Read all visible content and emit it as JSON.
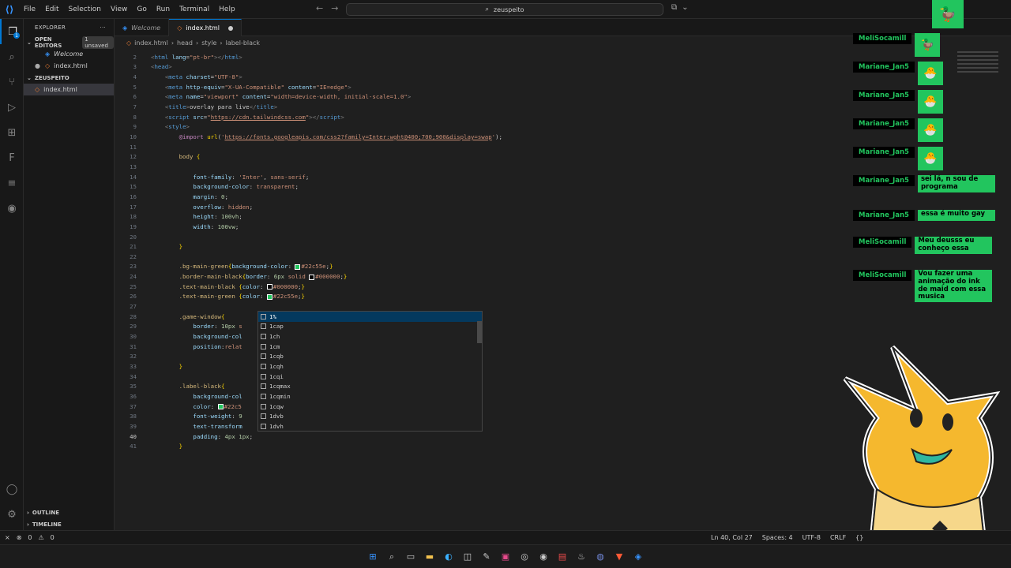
{
  "menu": [
    "File",
    "Edit",
    "Selection",
    "View",
    "Go",
    "Run",
    "Terminal",
    "Help"
  ],
  "command_center": "zeuspeito",
  "explorer": {
    "title": "EXPLORER",
    "open_editors": "OPEN EDITORS",
    "unsaved_badge": "1 unsaved",
    "open_items": [
      "Welcome",
      "index.html"
    ],
    "project": "ZEUSPEITO",
    "project_items": [
      "index.html"
    ],
    "outline": "OUTLINE",
    "timeline": "TIMELINE"
  },
  "tabs": [
    {
      "label": "Welcome"
    },
    {
      "label": "index.html"
    }
  ],
  "breadcrumb": [
    "index.html",
    "head",
    "style",
    "label-black"
  ],
  "code_lines": [
    {
      "n": "2",
      "segs": [
        [
          "punc",
          "<"
        ],
        [
          "tag",
          "html "
        ],
        [
          "attr",
          "lang"
        ],
        [
          "txt",
          "="
        ],
        [
          "str",
          "\"pt-br\""
        ],
        [
          "punc",
          "></"
        ],
        [
          "tag",
          "html"
        ],
        [
          "punc",
          ">"
        ]
      ]
    },
    {
      "n": "3",
      "segs": [
        [
          "punc",
          "<"
        ],
        [
          "tag",
          "head"
        ],
        [
          "punc",
          ">"
        ]
      ]
    },
    {
      "n": "4",
      "segs": [
        [
          "txt",
          "    "
        ],
        [
          "punc",
          "<"
        ],
        [
          "tag",
          "meta "
        ],
        [
          "attr",
          "charset"
        ],
        [
          "txt",
          "="
        ],
        [
          "str",
          "\"UTF-8\""
        ],
        [
          "punc",
          ">"
        ]
      ]
    },
    {
      "n": "5",
      "segs": [
        [
          "txt",
          "    "
        ],
        [
          "punc",
          "<"
        ],
        [
          "tag",
          "meta "
        ],
        [
          "attr",
          "http-equiv"
        ],
        [
          "txt",
          "="
        ],
        [
          "str",
          "\"X-UA-Compatible\""
        ],
        [
          "txt",
          " "
        ],
        [
          "attr",
          "content"
        ],
        [
          "txt",
          "="
        ],
        [
          "str",
          "\"IE=edge\""
        ],
        [
          "punc",
          ">"
        ]
      ]
    },
    {
      "n": "6",
      "segs": [
        [
          "txt",
          "    "
        ],
        [
          "punc",
          "<"
        ],
        [
          "tag",
          "meta "
        ],
        [
          "attr",
          "name"
        ],
        [
          "txt",
          "="
        ],
        [
          "str",
          "\"viewport\""
        ],
        [
          "txt",
          " "
        ],
        [
          "attr",
          "content"
        ],
        [
          "txt",
          "="
        ],
        [
          "str",
          "\"width=device-width, initial-scale=1.0\""
        ],
        [
          "punc",
          ">"
        ]
      ]
    },
    {
      "n": "7",
      "segs": [
        [
          "txt",
          "    "
        ],
        [
          "punc",
          "<"
        ],
        [
          "tag",
          "title"
        ],
        [
          "punc",
          ">"
        ],
        [
          "txt",
          "overlay para live"
        ],
        [
          "punc",
          "</"
        ],
        [
          "tag",
          "title"
        ],
        [
          "punc",
          ">"
        ]
      ]
    },
    {
      "n": "8",
      "segs": [
        [
          "txt",
          "    "
        ],
        [
          "punc",
          "<"
        ],
        [
          "tag",
          "script "
        ],
        [
          "attr",
          "src"
        ],
        [
          "txt",
          "="
        ],
        [
          "str",
          "\""
        ],
        [
          "link",
          "https://cdn.tailwindcss.com"
        ],
        [
          "str",
          "\""
        ],
        [
          "punc",
          "></"
        ],
        [
          "tag",
          "script"
        ],
        [
          "punc",
          ">"
        ]
      ]
    },
    {
      "n": "9",
      "segs": [
        [
          "txt",
          "    "
        ],
        [
          "punc",
          "<"
        ],
        [
          "tag",
          "style"
        ],
        [
          "punc",
          ">"
        ]
      ]
    },
    {
      "n": "10",
      "segs": [
        [
          "txt",
          "        "
        ],
        [
          "at",
          "@import "
        ],
        [
          "yel",
          "url"
        ],
        [
          "txt",
          "("
        ],
        [
          "str",
          "'"
        ],
        [
          "link",
          "https://fonts.googleapis.com/css2?family=Inter:wght@400;700;900&display=swap"
        ],
        [
          "str",
          "'"
        ],
        [
          "txt",
          ");"
        ]
      ]
    },
    {
      "n": "11",
      "segs": []
    },
    {
      "n": "12",
      "segs": [
        [
          "txt",
          "        "
        ],
        [
          "sel",
          "body "
        ],
        [
          "yel",
          "{"
        ]
      ]
    },
    {
      "n": "13",
      "segs": []
    },
    {
      "n": "14",
      "segs": [
        [
          "txt",
          "            "
        ],
        [
          "prop",
          "font-family"
        ],
        [
          "txt",
          ": "
        ],
        [
          "str",
          "'Inter'"
        ],
        [
          "txt",
          ", "
        ],
        [
          "str",
          "sans-serif"
        ],
        [
          "txt",
          ";"
        ]
      ]
    },
    {
      "n": "15",
      "segs": [
        [
          "txt",
          "            "
        ],
        [
          "prop",
          "background-color"
        ],
        [
          "txt",
          ": "
        ],
        [
          "str",
          "transparent"
        ],
        [
          "txt",
          ";"
        ]
      ]
    },
    {
      "n": "16",
      "segs": [
        [
          "txt",
          "            "
        ],
        [
          "prop",
          "margin"
        ],
        [
          "txt",
          ": "
        ],
        [
          "num",
          "0"
        ],
        [
          "txt",
          ";"
        ]
      ]
    },
    {
      "n": "17",
      "segs": [
        [
          "txt",
          "            "
        ],
        [
          "prop",
          "overflow"
        ],
        [
          "txt",
          ": "
        ],
        [
          "str",
          "hidden"
        ],
        [
          "txt",
          ";"
        ]
      ]
    },
    {
      "n": "18",
      "segs": [
        [
          "txt",
          "            "
        ],
        [
          "prop",
          "height"
        ],
        [
          "txt",
          ": "
        ],
        [
          "num",
          "100vh"
        ],
        [
          "txt",
          ";"
        ]
      ]
    },
    {
      "n": "19",
      "segs": [
        [
          "txt",
          "            "
        ],
        [
          "prop",
          "width"
        ],
        [
          "txt",
          ": "
        ],
        [
          "num",
          "100vw"
        ],
        [
          "txt",
          ";"
        ]
      ]
    },
    {
      "n": "20",
      "segs": []
    },
    {
      "n": "21",
      "segs": [
        [
          "txt",
          "        "
        ],
        [
          "yel",
          "}"
        ]
      ]
    },
    {
      "n": "22",
      "segs": []
    },
    {
      "n": "23",
      "segs": [
        [
          "txt",
          "        "
        ],
        [
          "sel",
          ".bg-main-green"
        ],
        [
          "yel",
          "{"
        ],
        [
          "prop",
          "background-color"
        ],
        [
          "txt",
          ": "
        ],
        [
          "swg",
          ""
        ],
        [
          "str",
          "#22c55e"
        ],
        [
          "txt",
          ";"
        ],
        [
          "yel",
          "}"
        ]
      ]
    },
    {
      "n": "24",
      "segs": [
        [
          "txt",
          "        "
        ],
        [
          "sel",
          ".border-main-black"
        ],
        [
          "yel",
          "{"
        ],
        [
          "prop",
          "border"
        ],
        [
          "txt",
          ": "
        ],
        [
          "num",
          "6px "
        ],
        [
          "str",
          "solid "
        ],
        [
          "swb",
          ""
        ],
        [
          "str",
          "#000000"
        ],
        [
          "txt",
          ";"
        ],
        [
          "yel",
          "}"
        ]
      ]
    },
    {
      "n": "25",
      "segs": [
        [
          "txt",
          "        "
        ],
        [
          "sel",
          ".text-main-black "
        ],
        [
          "yel",
          "{"
        ],
        [
          "prop",
          "color"
        ],
        [
          "txt",
          ": "
        ],
        [
          "swb",
          ""
        ],
        [
          "str",
          "#000000"
        ],
        [
          "txt",
          ";"
        ],
        [
          "yel",
          "}"
        ]
      ]
    },
    {
      "n": "26",
      "segs": [
        [
          "txt",
          "        "
        ],
        [
          "sel",
          ".text-main-green "
        ],
        [
          "yel",
          "{"
        ],
        [
          "prop",
          "color"
        ],
        [
          "txt",
          ": "
        ],
        [
          "swg",
          ""
        ],
        [
          "str",
          "#22c55e"
        ],
        [
          "txt",
          ";"
        ],
        [
          "yel",
          "}"
        ]
      ]
    },
    {
      "n": "27",
      "segs": []
    },
    {
      "n": "28",
      "segs": [
        [
          "txt",
          "        "
        ],
        [
          "sel",
          ".game-window"
        ],
        [
          "yel",
          "{"
        ]
      ]
    },
    {
      "n": "29",
      "segs": [
        [
          "txt",
          "            "
        ],
        [
          "prop",
          "border"
        ],
        [
          "txt",
          ": "
        ],
        [
          "num",
          "10px "
        ],
        [
          "str",
          "s"
        ]
      ]
    },
    {
      "n": "30",
      "segs": [
        [
          "txt",
          "            "
        ],
        [
          "prop",
          "background-col"
        ]
      ]
    },
    {
      "n": "31",
      "segs": [
        [
          "txt",
          "            "
        ],
        [
          "prop",
          "position"
        ],
        [
          "txt",
          ":"
        ],
        [
          "str",
          "relat"
        ]
      ]
    },
    {
      "n": "32",
      "segs": []
    },
    {
      "n": "33",
      "segs": [
        [
          "txt",
          "        "
        ],
        [
          "yel",
          "}"
        ]
      ]
    },
    {
      "n": "34",
      "segs": []
    },
    {
      "n": "35",
      "segs": [
        [
          "txt",
          "        "
        ],
        [
          "sel",
          ".label-black"
        ],
        [
          "yel",
          "{"
        ]
      ]
    },
    {
      "n": "36",
      "segs": [
        [
          "txt",
          "            "
        ],
        [
          "prop",
          "background-col"
        ]
      ]
    },
    {
      "n": "37",
      "segs": [
        [
          "txt",
          "            "
        ],
        [
          "prop",
          "color"
        ],
        [
          "txt",
          ": "
        ],
        [
          "swg",
          ""
        ],
        [
          "str",
          "#22c5"
        ]
      ]
    },
    {
      "n": "38",
      "segs": [
        [
          "txt",
          "            "
        ],
        [
          "prop",
          "font-weight"
        ],
        [
          "txt",
          ": "
        ],
        [
          "num",
          "9"
        ]
      ]
    },
    {
      "n": "39",
      "segs": [
        [
          "txt",
          "            "
        ],
        [
          "prop",
          "text-transform"
        ]
      ]
    },
    {
      "n": "40",
      "segs": [
        [
          "txt",
          "            "
        ],
        [
          "prop",
          "padding"
        ],
        [
          "txt",
          ": "
        ],
        [
          "num",
          "4px 1px"
        ],
        [
          "txt",
          ";"
        ]
      ]
    },
    {
      "n": "41",
      "segs": [
        [
          "txt",
          "        "
        ],
        [
          "yel",
          "}"
        ]
      ]
    }
  ],
  "suggestions": [
    "1%",
    "1cap",
    "1ch",
    "1cm",
    "1cqb",
    "1cqh",
    "1cqi",
    "1cqmax",
    "1cqmin",
    "1cqw",
    "1dvb",
    "1dvh"
  ],
  "chat": [
    {
      "name": "MeliSocamill",
      "emote": "🦆"
    },
    {
      "name": "Mariane_Jan5",
      "emote": "🐣"
    },
    {
      "name": "Mariane_Jan5",
      "emote": "🐣"
    },
    {
      "name": "Mariane_Jan5",
      "emote": "🐣"
    },
    {
      "name": "Mariane_Jan5",
      "emote": "🐣"
    },
    {
      "name": "Mariane_Jan5",
      "msg": "sei lá, n sou de programa"
    },
    {
      "name": "Mariane_Jan5",
      "msg": "essa é muito gay"
    },
    {
      "name": "MeliSocamill",
      "msg": "Meu deusss eu conheço essa"
    },
    {
      "name": "MeliSocamill",
      "msg": "Vou fazer uma animação do ink de maid com essa musica"
    }
  ],
  "status": {
    "errors": "0",
    "warnings": "0",
    "position": "Ln 40, Col 27",
    "spaces": "Spaces: 4",
    "encoding": "UTF-8",
    "eol": "CRLF"
  },
  "colors": {
    "accent": "#0078d4",
    "green": "#22c55e"
  }
}
